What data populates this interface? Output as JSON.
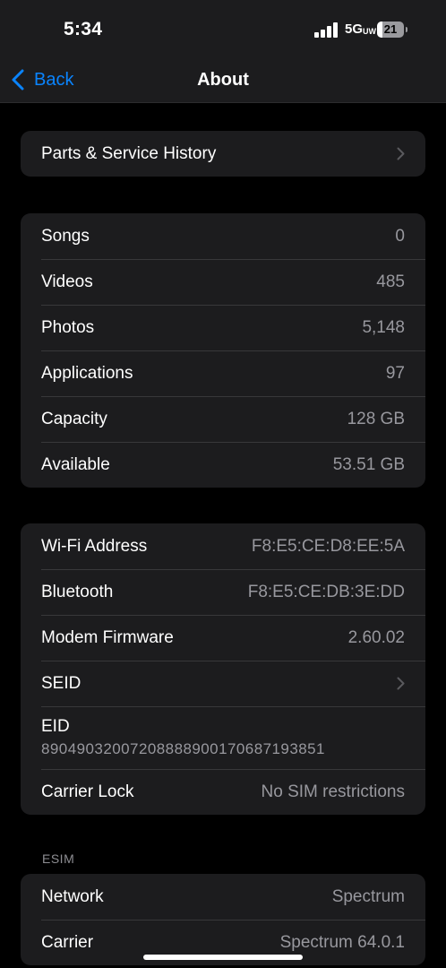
{
  "status_bar": {
    "time": "5:34",
    "network": "5G",
    "network_sub": "UW",
    "battery": "21",
    "battery_level": 0.21
  },
  "nav": {
    "back_label": "Back",
    "title": "About"
  },
  "group1": {
    "rows": [
      {
        "label": "Parts & Service History"
      }
    ]
  },
  "group2": {
    "rows": [
      {
        "label": "Songs",
        "value": "0"
      },
      {
        "label": "Videos",
        "value": "485"
      },
      {
        "label": "Photos",
        "value": "5,148"
      },
      {
        "label": "Applications",
        "value": "97"
      },
      {
        "label": "Capacity",
        "value": "128 GB"
      },
      {
        "label": "Available",
        "value": "53.51 GB"
      }
    ]
  },
  "group3": {
    "rows": [
      {
        "label": "Wi-Fi Address",
        "value": "F8:E5:CE:D8:EE:5A"
      },
      {
        "label": "Bluetooth",
        "value": "F8:E5:CE:DB:3E:DD"
      },
      {
        "label": "Modem Firmware",
        "value": "2.60.02"
      },
      {
        "label": "SEID"
      },
      {
        "label": "EID",
        "value": "89049032007208888900170687193851"
      },
      {
        "label": "Carrier Lock",
        "value": "No SIM restrictions"
      }
    ]
  },
  "esim": {
    "header": "ESIM",
    "rows": [
      {
        "label": "Network",
        "value": "Spectrum"
      },
      {
        "label": "Carrier",
        "value": "Spectrum 64.0.1"
      }
    ]
  },
  "colors": {
    "accent": "#0a84ff",
    "background": "#000000",
    "cell": "#1c1c1e",
    "secondary_text": "#98989e"
  }
}
